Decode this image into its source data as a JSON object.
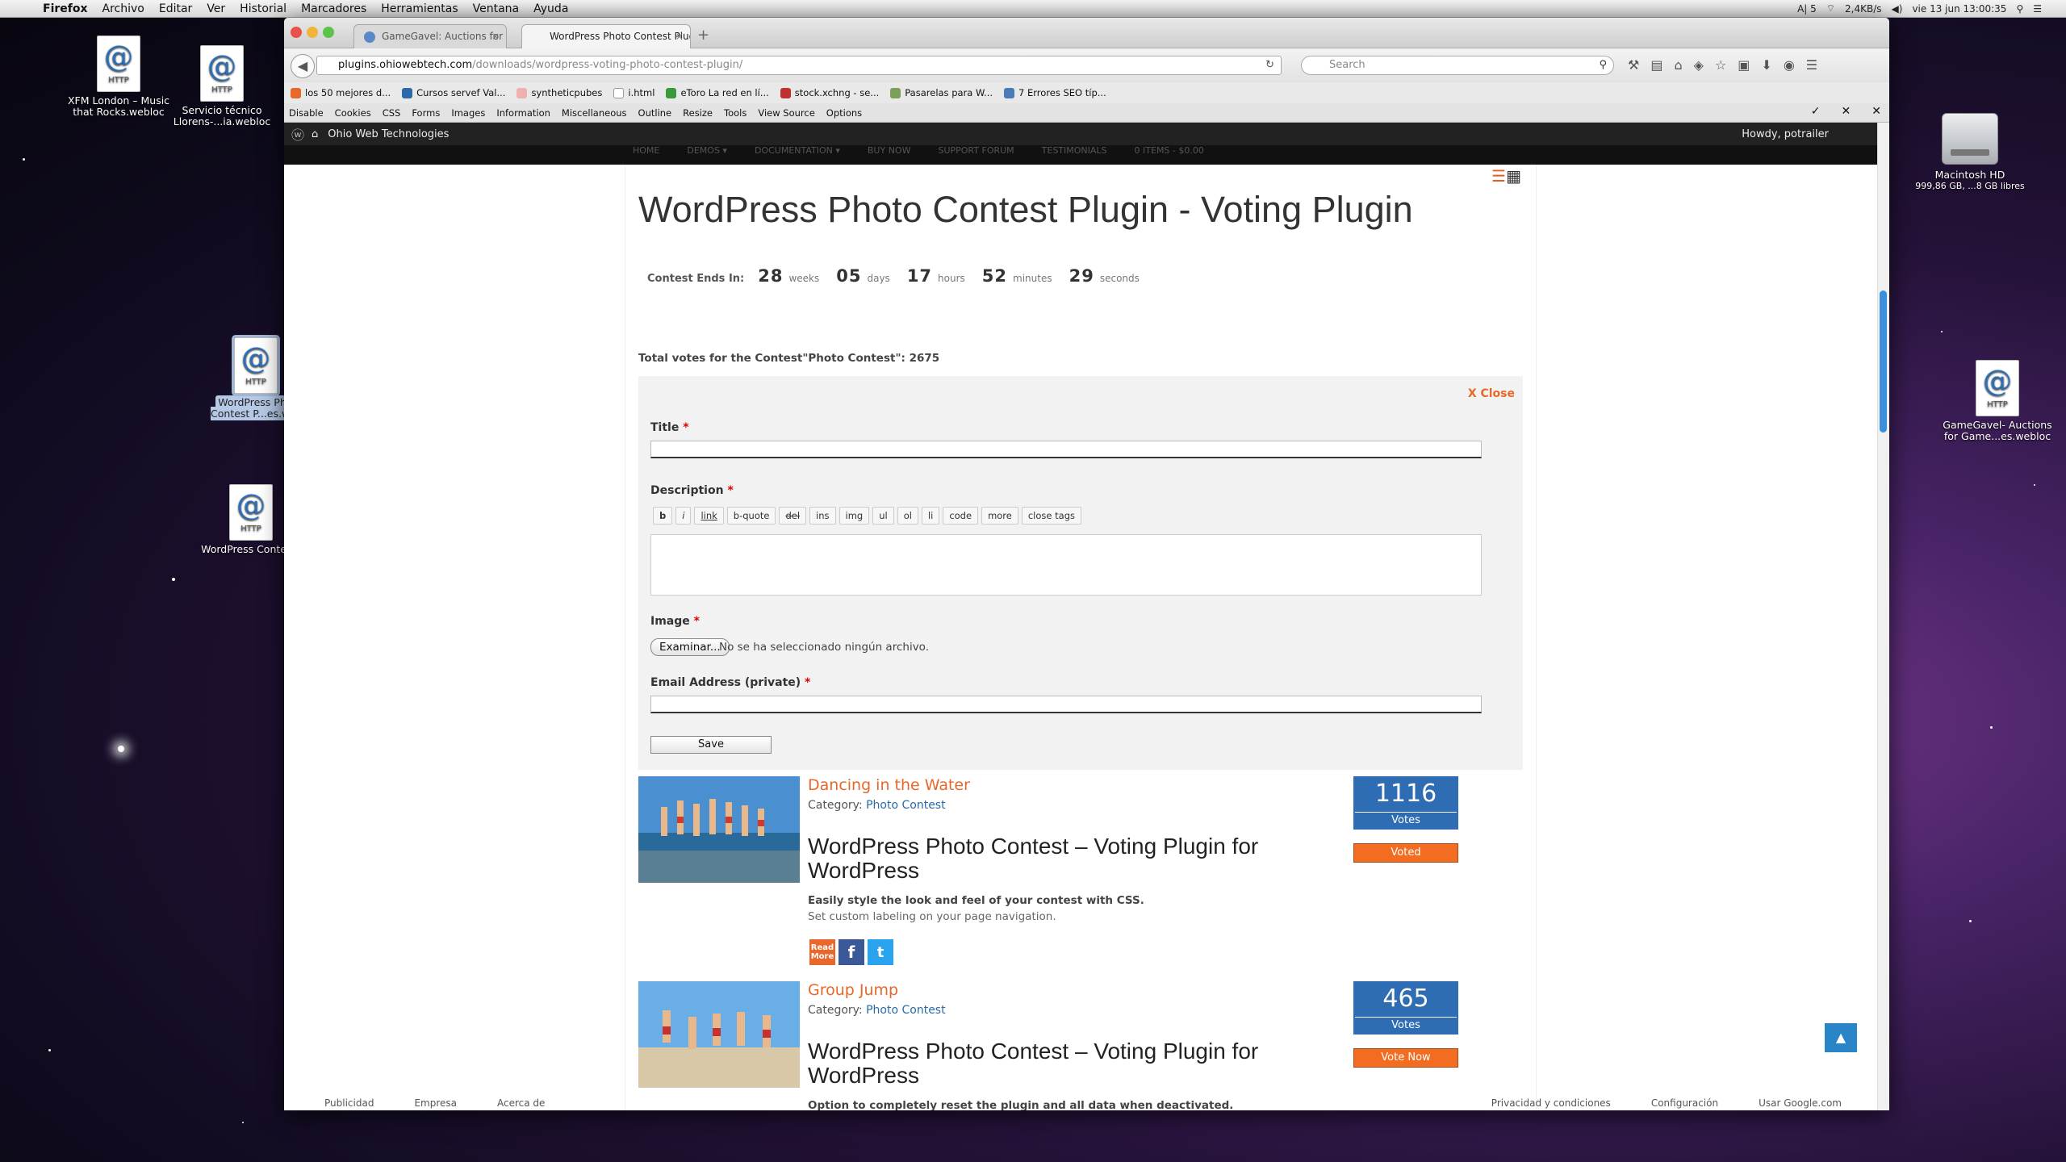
{
  "menubar": {
    "app": "Firefox",
    "items": [
      "Archivo",
      "Editar",
      "Ver",
      "Historial",
      "Marcadores",
      "Herramientas",
      "Ventana",
      "Ayuda"
    ],
    "status": [
      "A| 5",
      "2,4KB/s",
      "vie 13 jun  13:00:35"
    ]
  },
  "desktop": {
    "icons": [
      {
        "label": "XFM London – Music that Rocks.webloc"
      },
      {
        "label": "Servicio técnico Llorens-...ia.webloc"
      },
      {
        "label": "WordPress Ph... Contest P...es.w..."
      },
      {
        "label": "WordPress Contests"
      },
      {
        "label": "Macintosh HD",
        "sub": "999,86 GB, ...8 GB libres"
      },
      {
        "label": "GameGavel- Auctions for Game...es.webloc"
      }
    ],
    "file_glyph": "@",
    "file_type": "HTTP"
  },
  "browser": {
    "tabs": [
      {
        "label": "GameGavel: Auctions for ..."
      },
      {
        "label": "WordPress Photo Contest Plug..."
      }
    ],
    "new_tab": "+",
    "url_domain": "plugins.ohiowebtech.com",
    "url_path": "/downloads/wordpress-voting-photo-contest-plugin/",
    "search_placeholder": "Search",
    "bookmarks": [
      "los 50 mejores d...",
      "Cursos servef Val...",
      "syntheticpubes",
      "i.html",
      "eToro La red en lí...",
      "stock.xchng - se...",
      "Pasarelas para W...",
      "7 Errores SEO típ..."
    ],
    "devtools": [
      "Disable",
      "Cookies",
      "CSS",
      "Forms",
      "Images",
      "Information",
      "Miscellaneous",
      "Outline",
      "Resize",
      "Tools",
      "View Source",
      "Options"
    ]
  },
  "wp": {
    "site": "Ohio Web Technologies",
    "howdy": "Howdy, potrailer",
    "nav": [
      "HOME",
      "DEMOS ▾",
      "DOCUMENTATION ▾",
      "BUY NOW",
      "SUPPORT FORUM",
      "TESTIMONIALS",
      "0 ITEMS - $0.00"
    ]
  },
  "page": {
    "title": "WordPress Photo Contest Plugin - Voting Plugin",
    "timer": {
      "label": "Contest Ends In:",
      "weeks": "28",
      "weeks_u": "weeks",
      "days": "05",
      "days_u": "days",
      "hours": "17",
      "hours_u": "hours",
      "minutes": "52",
      "minutes_u": "minutes",
      "seconds": "29",
      "seconds_u": "seconds"
    },
    "total_votes": "Total votes for the Contest\"Photo Contest\": 2675",
    "form": {
      "close": "X Close",
      "title_label": "Title",
      "description_label": "Description",
      "image_label": "Image",
      "email_label": "Email Address (private)",
      "required": "*",
      "quicktags": [
        "b",
        "i",
        "link",
        "b-quote",
        "del",
        "ins",
        "img",
        "ul",
        "ol",
        "li",
        "code",
        "more",
        "close tags"
      ],
      "browse": "Examinar...",
      "no_file": "No se ha seleccionado ningún archivo.",
      "save": "Save"
    },
    "entries": [
      {
        "title": "Dancing in the Water",
        "category_label": "Category:",
        "category": "Photo Contest",
        "heading": "WordPress Photo Contest – Voting Plugin for WordPress",
        "desc_bold": "Easily style the look and feel of your contest with CSS.",
        "desc": "Set custom labeling on your page navigation.",
        "votes": "1116",
        "votes_label": "Votes",
        "button": "Voted",
        "read_more": "Read More"
      },
      {
        "title": "Group Jump",
        "category_label": "Category:",
        "category": "Photo Contest",
        "heading": "WordPress Photo Contest – Voting Plugin for WordPress",
        "desc_bold": "Option to completely reset the plugin and all data when deactivated.",
        "desc": "",
        "votes": "465",
        "votes_label": "Votes",
        "button": "Vote Now"
      }
    ]
  },
  "statusbar": [
    "Publicidad",
    "Empresa",
    "Acerca de",
    "Privacidad y condiciones",
    "Configuración",
    "Usar Google.com"
  ],
  "colors": {
    "accent": "#e8672a",
    "votes_bg": "#2e6db3",
    "button": "#f26d21",
    "link": "#2a6aa8"
  }
}
